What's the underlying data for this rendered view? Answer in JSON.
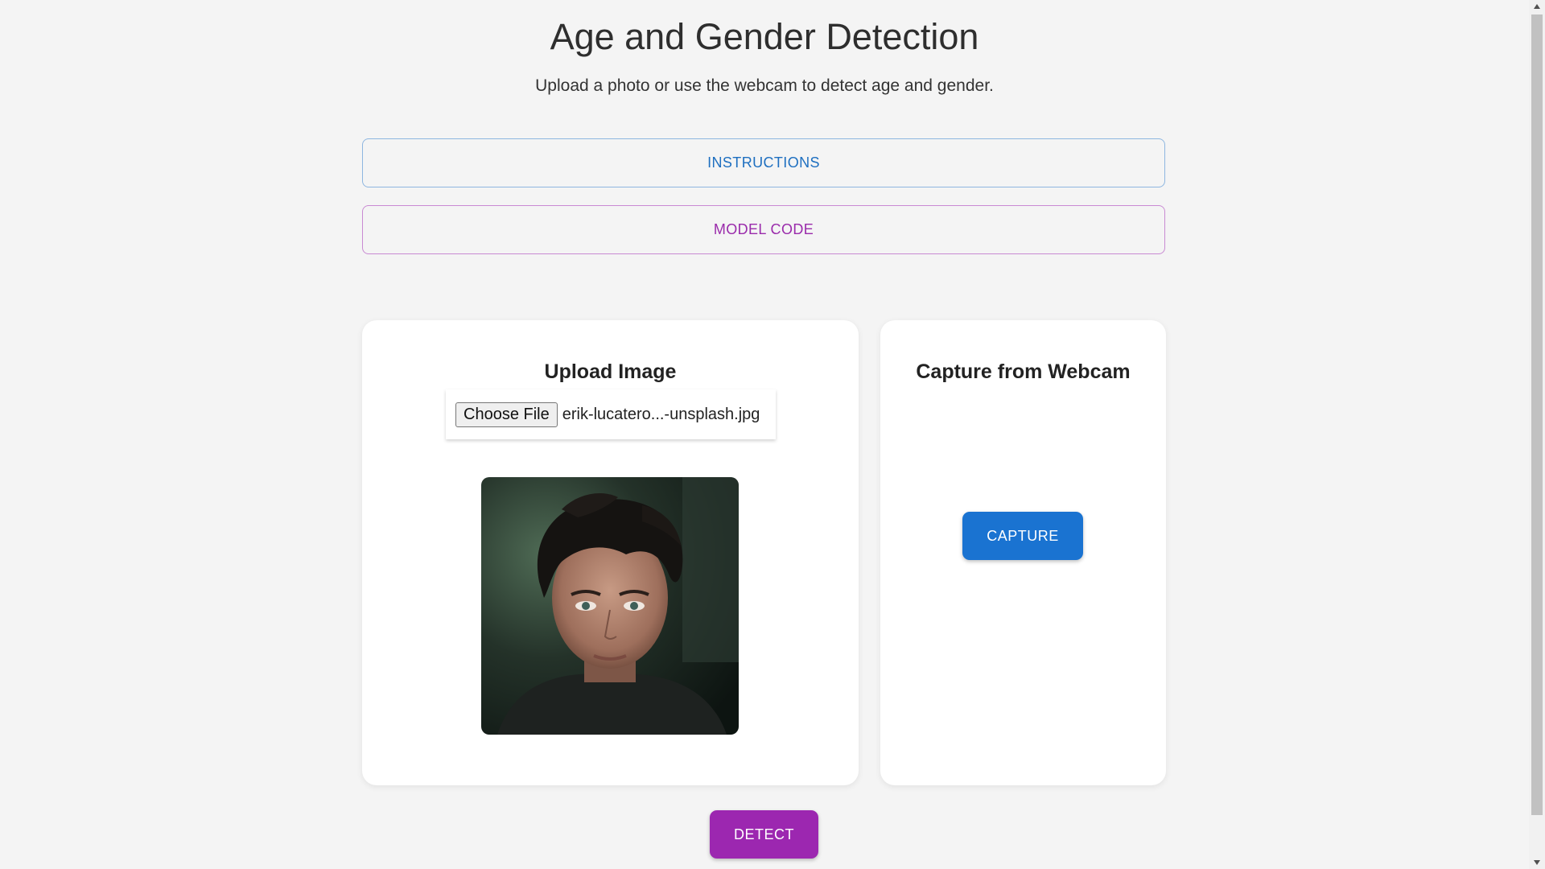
{
  "header": {
    "title": "Age and Gender Detection",
    "subtitle": "Upload a photo or use the webcam to detect age and gender."
  },
  "accordions": {
    "instructions_label": "INSTRUCTIONS",
    "model_code_label": "MODEL CODE"
  },
  "upload_card": {
    "title": "Upload Image",
    "choose_file_label": "Choose File",
    "file_name": "erik-lucatero...-unsplash.jpg",
    "preview_image": "portrait-photo"
  },
  "webcam_card": {
    "title": "Capture from Webcam",
    "capture_label": "CAPTURE"
  },
  "actions": {
    "detect_label": "DETECT"
  },
  "colors": {
    "background": "#f4f4f4",
    "instructions_accent": "#1e6fc0",
    "model_code_accent": "#9a2bab",
    "capture_button": "#1a73d1",
    "detect_button": "#9c27b0"
  },
  "icons": {
    "scroll_up": "triangle-up-icon",
    "scroll_down": "triangle-down-icon"
  }
}
